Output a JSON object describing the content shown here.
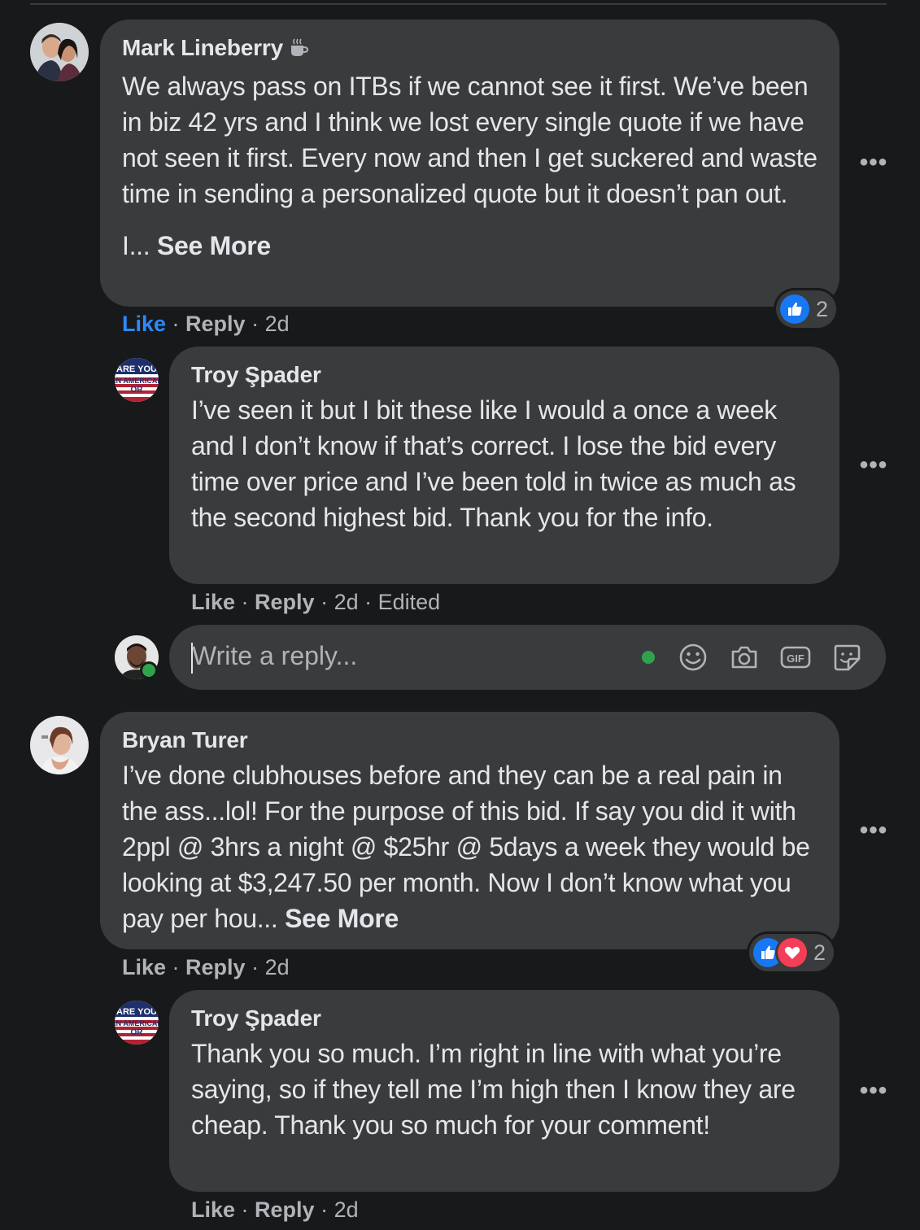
{
  "comments": [
    {
      "author": "Mark Lineberry",
      "badge_icon": "coffee-cup-icon",
      "text": "We always pass on ITBs if we cannot see it first. We’ve been in biz 42 yrs and I think we lost every single quote if we have not seen it first. Every now and then I get suckered and waste time in sending a personalized quote but it doesn’t pan out.",
      "text_tail": "I... ",
      "see_more": "See More",
      "like": "Like",
      "reply": "Reply",
      "time": "2d",
      "liked_by_viewer": true,
      "reaction_count": "2",
      "reactions": [
        "like"
      ]
    },
    {
      "author": "Troy Şpader",
      "text": "I’ve seen it but I bit these like I would a once a week and I don’t know if that’s correct. I lose the bid every time over price and I’ve been told in twice as much as the second highest bid. Thank you for the info.",
      "like": "Like",
      "reply": "Reply",
      "time": "2d",
      "edited": "Edited"
    },
    {
      "author": "Bryan Turer",
      "text": "I’ve done clubhouses before and they can be a real pain in the ass...lol! For the purpose of this bid. If say you did it with 2ppl @ 3hrs a night @ $25hr @ 5days a week they would be looking at $3,247.50 per month. Now I don’t know what you pay per hou... ",
      "see_more": "See More",
      "like": "Like",
      "reply": "Reply",
      "time": "2d",
      "reaction_count": "2",
      "reactions": [
        "like",
        "love"
      ]
    },
    {
      "author": "Troy Şpader",
      "text": "Thank you so much. I’m right in line with what you’re saying, so if they tell me I’m high then I know they are cheap. Thank you so much for your comment!",
      "like": "Like",
      "reply": "Reply",
      "time": "2d"
    }
  ],
  "reply_box": {
    "placeholder": "Write a reply...",
    "tools": [
      "emoji-icon",
      "camera-icon",
      "gif-icon",
      "sticker-icon"
    ]
  },
  "avatar_badge_text": "ARE YOU AN AMERICAN OR",
  "colors": {
    "background": "#18191a",
    "bubble": "#3a3b3c",
    "text": "#e4e6eb",
    "secondary_text": "#b0b3b8",
    "link_blue": "#2d88ff",
    "like_blue": "#1877f2",
    "love_red": "#f33e58",
    "online_green": "#31a24c"
  }
}
